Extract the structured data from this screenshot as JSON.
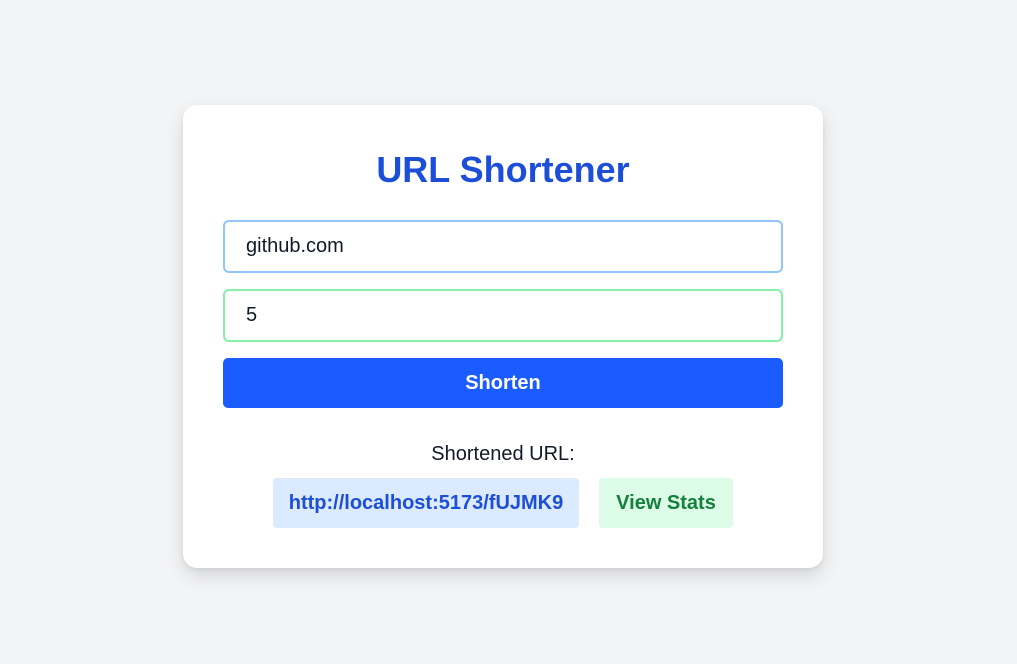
{
  "app": {
    "title": "URL Shortener"
  },
  "form": {
    "url_value": "github.com",
    "validity_value": "5",
    "submit_label": "Shorten"
  },
  "result": {
    "label": "Shortened URL:",
    "short_url": "http://localhost:5173/fUJMK9",
    "stats_label": "View Stats"
  },
  "colors": {
    "background": "#f3f4f6",
    "card": "#ffffff",
    "title": "#1d4ed8",
    "primary_button": "#1a5cff",
    "url_field_border": "#93c5fd",
    "validity_field_border": "#86efac",
    "link_background": "#dbeafe",
    "link_text": "#1d4ed8",
    "stats_background": "#dcfce7",
    "stats_text": "#15803d"
  }
}
